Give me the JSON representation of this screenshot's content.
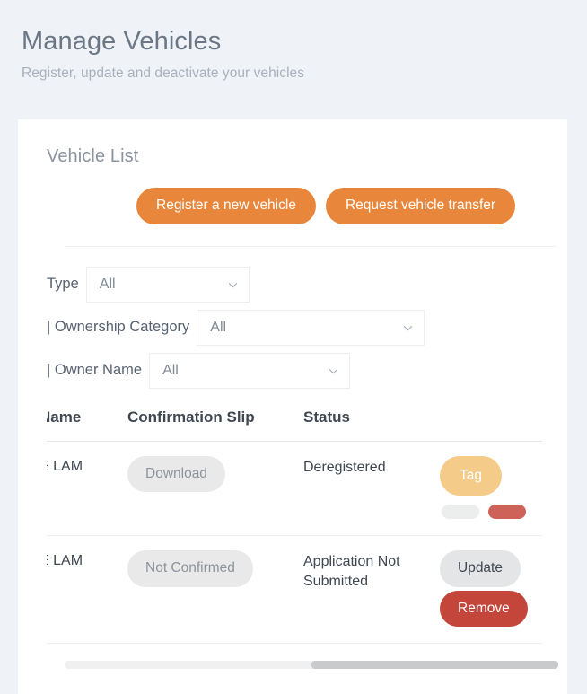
{
  "page": {
    "title": "Manage Vehicles",
    "subtitle": "Register, update and deactivate your vehicles"
  },
  "card": {
    "title": "Vehicle List",
    "actions": {
      "register_label": "Register a new vehicle",
      "transfer_label": "Request vehicle transfer"
    }
  },
  "filters": [
    {
      "label": "Type",
      "value": "All",
      "icon": "chevron-down-icon"
    },
    {
      "label": "| Ownership Category",
      "value": "All",
      "icon": "chevron-down-icon"
    },
    {
      "label": "| Owner Name",
      "value": "All",
      "icon": "chevron-down-icon"
    }
  ],
  "table": {
    "columns": [
      {
        "key": "name",
        "label": "Name"
      },
      {
        "key": "slip",
        "label": "Confirmation Slip"
      },
      {
        "key": "status",
        "label": "Status"
      },
      {
        "key": "action",
        "label": ""
      }
    ],
    "rows": [
      {
        "name": "E LAM",
        "slip_label": "Download",
        "slip_state": "disabled",
        "status": "Deregistered",
        "primary_action": "Tag",
        "extra_actions": [
          "",
          ""
        ]
      },
      {
        "name": "E LAM",
        "slip_label": "Not Confirmed",
        "slip_state": "disabled",
        "status": "Application Not Submitted",
        "primary_action": "Update",
        "secondary_action": "Remove"
      }
    ]
  },
  "scrollbar": {
    "orientation": "horizontal",
    "thumb_position_percent": 50,
    "thumb_width_percent": 50
  },
  "colors": {
    "page_background": "#eff2f7",
    "card_background": "#ffffff",
    "accent_orange": "#e8873c",
    "tag_orange": "#f5cb8a",
    "danger_red": "#c4453a",
    "neutral_gray": "#e9e9ea",
    "title_text": "#6b7785",
    "subtitle_text": "#a9b1bd"
  }
}
